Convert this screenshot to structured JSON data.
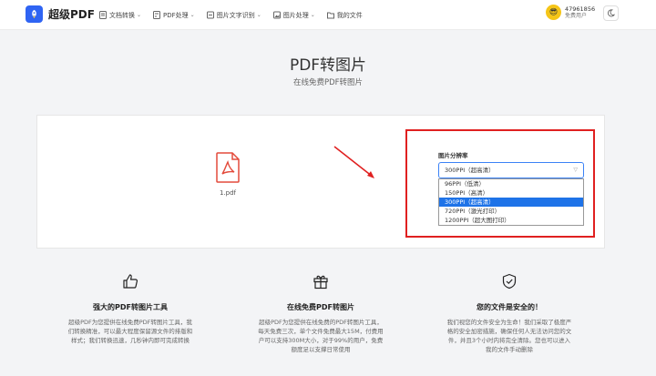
{
  "app": {
    "name": "超级PDF"
  },
  "nav": {
    "items": [
      {
        "label": "文档转换",
        "has_dropdown": true,
        "icon": "document-convert-icon"
      },
      {
        "label": "PDF处理",
        "has_dropdown": true,
        "icon": "pdf-icon"
      },
      {
        "label": "图片文字识别",
        "has_dropdown": true,
        "icon": "ocr-icon"
      },
      {
        "label": "图片处理",
        "has_dropdown": true,
        "icon": "image-icon"
      },
      {
        "label": "我的文件",
        "has_dropdown": false,
        "icon": "folder-icon"
      }
    ],
    "user": {
      "id": "47961856",
      "level": "免费用户"
    }
  },
  "page": {
    "title": "PDF转图片",
    "subtitle": "在线免费PDF转图片"
  },
  "upload": {
    "file_name": "1.pdf"
  },
  "resolution": {
    "label": "图片分辨率",
    "selected": "300PPI（超高清）",
    "options": [
      "96PPI（低清）",
      "150PPI（高清）",
      "300PPI（超高清）",
      "720PPI（激光打印）",
      "1200PPI（超大图打印）"
    ],
    "selected_index": 2
  },
  "features": [
    {
      "icon": "thumbs-up-icon",
      "title": "强大的PDF转图片工具",
      "lines": [
        "超级PDF为您提供在线免费PDF转图片工具，我",
        "们转换精准，可以最大程度保留源文件的排版和",
        "样式；我们转换迅速，几秒钟内即可完成转换"
      ]
    },
    {
      "icon": "gift-icon",
      "title": "在线免费PDF转图片",
      "lines": [
        "超级PDF为您提供在线免费的PDF转图片工具，",
        "每天免费三次，单个文件免费最大15M，付费用",
        "户可以支持300M大小，对于99%的用户，免费",
        "额度足以支撑日常使用"
      ]
    },
    {
      "icon": "shield-check-icon",
      "title": "您的文件是安全的！",
      "lines": [
        "我们视您的文件安全为生命！我们采取了极度严",
        "格的安全加密措施，确保任何人无法访问您的文",
        "件，并且3个小时内将完全清除。您也可以进入",
        "我的文件手动删除"
      ]
    }
  ],
  "colors": {
    "accent": "#2f64f3",
    "highlight": "#e02020",
    "option_selected": "#1e73e8",
    "pdf_red": "#e34a3b"
  }
}
